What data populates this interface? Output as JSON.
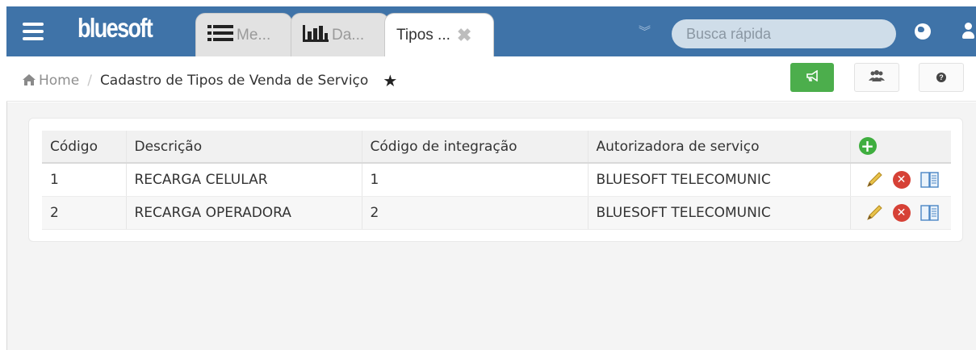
{
  "app": {
    "logo": "bluesoft",
    "tabs": [
      {
        "label": "Me...",
        "icon": "list-icon"
      },
      {
        "label": "Da...",
        "icon": "bar-chart-icon"
      },
      {
        "label": "Tipos ...",
        "icon": "close-icon",
        "active": true
      }
    ],
    "search": {
      "placeholder": "Busca rápida"
    },
    "colors": {
      "header": "#3f73a8",
      "green": "#4cae4c"
    }
  },
  "breadcrumb": {
    "home": "Home",
    "separator": "/",
    "current": "Cadastro de Tipos de Venda de Serviço"
  },
  "table": {
    "headers": [
      "Código",
      "Descrição",
      "Código de integração",
      "Autorizadora de serviço"
    ],
    "rows": [
      {
        "codigo": "1",
        "descricao": "RECARGA CELULAR",
        "integracao": "1",
        "autorizadora": "BLUESOFT TELECOMUNIC"
      },
      {
        "codigo": "2",
        "descricao": "RECARGA OPERADORA",
        "integracao": "2",
        "autorizadora": "BLUESOFT TELECOMUNIC"
      }
    ]
  }
}
